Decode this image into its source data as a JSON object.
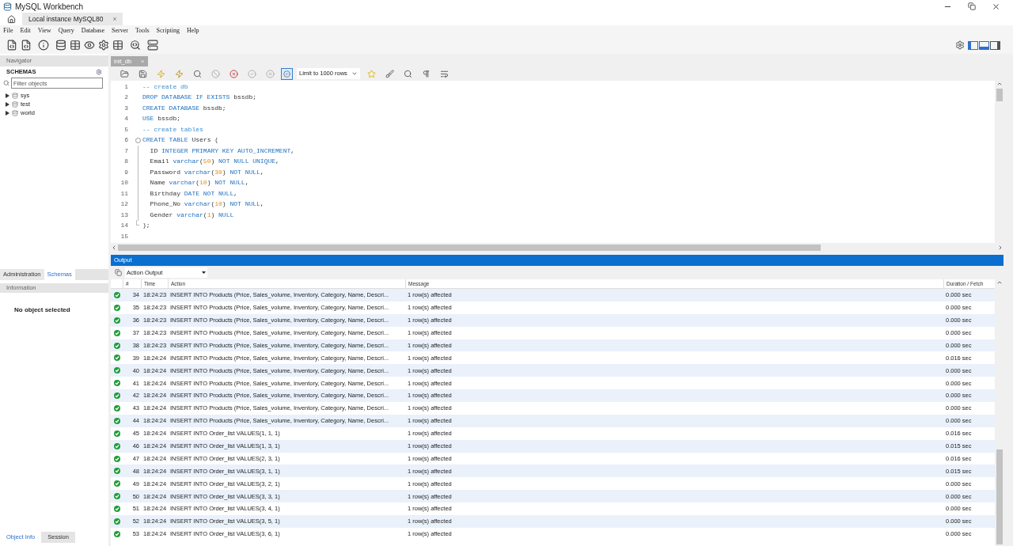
{
  "window": {
    "title": "MySQL Workbench"
  },
  "connection_tab": {
    "label": "Local instance MySQL80",
    "close": "×"
  },
  "menu": [
    "File",
    "Edit",
    "View",
    "Query",
    "Database",
    "Server",
    "Tools",
    "Scripting",
    "Help"
  ],
  "navigator": {
    "title": "Navigator",
    "section": "SCHEMAS",
    "filter_placeholder": "Filter objects",
    "schemas": [
      {
        "name": "sys",
        "expanded": false
      },
      {
        "name": "test",
        "expanded": false
      },
      {
        "name": "world",
        "expanded": false
      }
    ]
  },
  "side_tabs": [
    {
      "label": "Administration",
      "selected": false
    },
    {
      "label": "Schemas",
      "selected": true
    }
  ],
  "information": {
    "title": "Information",
    "message": "No object selected"
  },
  "info_tabs": [
    {
      "label": "Object Info",
      "selected": true
    },
    {
      "label": "Session",
      "selected": false
    }
  ],
  "editor": {
    "tab": "init_db",
    "tab_close": "×",
    "limit": "Limit to 1000 rows",
    "lines": [
      {
        "number": "1",
        "kind": "plain",
        "tokens": [
          {
            "kind": "comment",
            "text": "-- create db"
          }
        ]
      },
      {
        "number": "2",
        "kind": "plain",
        "tokens": [
          {
            "kind": "keyword",
            "text": "DROP DATABASE IF EXISTS "
          },
          {
            "kind": "ident",
            "text": "bssdb;"
          }
        ]
      },
      {
        "number": "3",
        "kind": "plain",
        "tokens": [
          {
            "kind": "keyword",
            "text": "CREATE DATABASE "
          },
          {
            "kind": "ident",
            "text": "bssdb;"
          }
        ]
      },
      {
        "number": "4",
        "kind": "plain",
        "tokens": [
          {
            "kind": "keyword",
            "text": "USE "
          },
          {
            "kind": "ident",
            "text": "bssdb;"
          }
        ]
      },
      {
        "number": "5",
        "kind": "plain",
        "tokens": [
          {
            "kind": "comment",
            "text": "-- create tables"
          }
        ]
      },
      {
        "number": "6",
        "kind": "fold_start",
        "tokens": [
          {
            "kind": "keyword",
            "text": "CREATE TABLE "
          },
          {
            "kind": "ident",
            "text": "Users ("
          }
        ]
      },
      {
        "number": "7",
        "kind": "fold_body",
        "tokens": [
          {
            "kind": "ident",
            "text": "  ID "
          },
          {
            "kind": "keyword",
            "text": "INTEGER PRIMARY KEY AUTO_INCREMENT"
          },
          {
            "kind": "ident",
            "text": ","
          }
        ]
      },
      {
        "number": "8",
        "kind": "fold_body",
        "tokens": [
          {
            "kind": "ident",
            "text": "  Email "
          },
          {
            "kind": "keyword",
            "text": "varchar"
          },
          {
            "kind": "ident",
            "text": "("
          },
          {
            "kind": "number",
            "text": "50"
          },
          {
            "kind": "ident",
            "text": ") "
          },
          {
            "kind": "keyword",
            "text": "NOT NULL UNIQUE"
          },
          {
            "kind": "ident",
            "text": ","
          }
        ]
      },
      {
        "number": "9",
        "kind": "fold_body",
        "tokens": [
          {
            "kind": "ident",
            "text": "  Password "
          },
          {
            "kind": "keyword",
            "text": "varchar"
          },
          {
            "kind": "ident",
            "text": "("
          },
          {
            "kind": "number",
            "text": "30"
          },
          {
            "kind": "ident",
            "text": ") "
          },
          {
            "kind": "keyword",
            "text": "NOT NULL"
          },
          {
            "kind": "ident",
            "text": ","
          }
        ]
      },
      {
        "number": "10",
        "kind": "fold_body",
        "tokens": [
          {
            "kind": "ident",
            "text": "  Name "
          },
          {
            "kind": "keyword",
            "text": "varchar"
          },
          {
            "kind": "ident",
            "text": "("
          },
          {
            "kind": "number",
            "text": "10"
          },
          {
            "kind": "ident",
            "text": ") "
          },
          {
            "kind": "keyword",
            "text": "NOT NULL"
          },
          {
            "kind": "ident",
            "text": ","
          }
        ]
      },
      {
        "number": "11",
        "kind": "fold_body",
        "tokens": [
          {
            "kind": "ident",
            "text": "  Birthday "
          },
          {
            "kind": "keyword",
            "text": "DATE NOT NULL"
          },
          {
            "kind": "ident",
            "text": ","
          }
        ]
      },
      {
        "number": "12",
        "kind": "fold_body",
        "tokens": [
          {
            "kind": "ident",
            "text": "  Phone_No "
          },
          {
            "kind": "keyword",
            "text": "varchar"
          },
          {
            "kind": "ident",
            "text": "("
          },
          {
            "kind": "number",
            "text": "10"
          },
          {
            "kind": "ident",
            "text": ") "
          },
          {
            "kind": "keyword",
            "text": "NOT NULL"
          },
          {
            "kind": "ident",
            "text": ","
          }
        ]
      },
      {
        "number": "13",
        "kind": "fold_body",
        "tokens": [
          {
            "kind": "ident",
            "text": "  Gender "
          },
          {
            "kind": "keyword",
            "text": "varchar"
          },
          {
            "kind": "ident",
            "text": "("
          },
          {
            "kind": "number",
            "text": "1"
          },
          {
            "kind": "ident",
            "text": ") "
          },
          {
            "kind": "keyword",
            "text": "NULL"
          }
        ]
      },
      {
        "number": "14",
        "kind": "fold_end",
        "tokens": [
          {
            "kind": "ident",
            "text": ");"
          }
        ]
      },
      {
        "number": "15",
        "kind": "plain"
      }
    ]
  },
  "output": {
    "title": "Output",
    "selector": "Action Output",
    "columns": [
      "#",
      "Time",
      "Action",
      "Message",
      "Duration / Fetch"
    ],
    "rows": [
      {
        "success": true,
        "number": "34",
        "time": "18:24:23",
        "action": "INSERT INTO Products (Price, Sales_volume, Inventory, Category, Name, Descri...",
        "message": "1 row(s) affected",
        "duration": "0.000 sec"
      },
      {
        "success": true,
        "number": "35",
        "time": "18:24:23",
        "action": "INSERT INTO Products (Price, Sales_volume, Inventory, Category, Name, Descri...",
        "message": "1 row(s) affected",
        "duration": "0.000 sec"
      },
      {
        "success": true,
        "number": "36",
        "time": "18:24:23",
        "action": "INSERT INTO Products (Price, Sales_volume, Inventory, Category, Name, Descri...",
        "message": "1 row(s) affected",
        "duration": "0.000 sec"
      },
      {
        "success": true,
        "number": "37",
        "time": "18:24:23",
        "action": "INSERT INTO Products (Price, Sales_volume, Inventory, Category, Name, Descri...",
        "message": "1 row(s) affected",
        "duration": "0.000 sec"
      },
      {
        "success": true,
        "number": "38",
        "time": "18:24:23",
        "action": "INSERT INTO Products (Price, Sales_volume, Inventory, Category, Name, Descri...",
        "message": "1 row(s) affected",
        "duration": "0.000 sec"
      },
      {
        "success": true,
        "number": "39",
        "time": "18:24:24",
        "action": "INSERT INTO Products (Price, Sales_volume, Inventory, Category, Name, Descri...",
        "message": "1 row(s) affected",
        "duration": "0.016 sec"
      },
      {
        "success": true,
        "number": "40",
        "time": "18:24:24",
        "action": "INSERT INTO Products (Price, Sales_volume, Inventory, Category, Name, Descri...",
        "message": "1 row(s) affected",
        "duration": "0.000 sec"
      },
      {
        "success": true,
        "number": "41",
        "time": "18:24:24",
        "action": "INSERT INTO Products (Price, Sales_volume, Inventory, Category, Name, Descri...",
        "message": "1 row(s) affected",
        "duration": "0.000 sec"
      },
      {
        "success": true,
        "number": "42",
        "time": "18:24:24",
        "action": "INSERT INTO Products (Price, Sales_volume, Inventory, Category, Name, Descri...",
        "message": "1 row(s) affected",
        "duration": "0.000 sec"
      },
      {
        "success": true,
        "number": "43",
        "time": "18:24:24",
        "action": "INSERT INTO Products (Price, Sales_volume, Inventory, Category, Name, Descri...",
        "message": "1 row(s) affected",
        "duration": "0.000 sec"
      },
      {
        "success": true,
        "number": "44",
        "time": "18:24:24",
        "action": "INSERT INTO Products (Price, Sales_volume, Inventory, Category, Name, Descri...",
        "message": "1 row(s) affected",
        "duration": "0.000 sec"
      },
      {
        "success": true,
        "number": "45",
        "time": "18:24:24",
        "action": "INSERT INTO Order_list VALUES(1, 1, 1)",
        "message": "1 row(s) affected",
        "duration": "0.016 sec"
      },
      {
        "success": true,
        "number": "46",
        "time": "18:24:24",
        "action": "INSERT INTO Order_list VALUES(1, 3, 1)",
        "message": "1 row(s) affected",
        "duration": "0.015 sec"
      },
      {
        "success": true,
        "number": "47",
        "time": "18:24:24",
        "action": "INSERT INTO Order_list VALUES(2, 3, 1)",
        "message": "1 row(s) affected",
        "duration": "0.016 sec"
      },
      {
        "success": true,
        "number": "48",
        "time": "18:24:24",
        "action": "INSERT INTO Order_list VALUES(3, 1, 1)",
        "message": "1 row(s) affected",
        "duration": "0.015 sec"
      },
      {
        "success": true,
        "number": "49",
        "time": "18:24:24",
        "action": "INSERT INTO Order_list VALUES(3, 2, 1)",
        "message": "1 row(s) affected",
        "duration": "0.000 sec"
      },
      {
        "success": true,
        "number": "50",
        "time": "18:24:24",
        "action": "INSERT INTO Order_list VALUES(3, 3, 1)",
        "message": "1 row(s) affected",
        "duration": "0.000 sec"
      },
      {
        "success": true,
        "number": "51",
        "time": "18:24:24",
        "action": "INSERT INTO Order_list VALUES(3, 4, 1)",
        "message": "1 row(s) affected",
        "duration": "0.000 sec"
      },
      {
        "success": true,
        "number": "52",
        "time": "18:24:24",
        "action": "INSERT INTO Order_list VALUES(3, 5, 1)",
        "message": "1 row(s) affected",
        "duration": "0.000 sec"
      },
      {
        "success": true,
        "number": "53",
        "time": "18:24:24",
        "action": "INSERT INTO Order_list VALUES(3, 6, 1)",
        "message": "1 row(s) affected",
        "duration": "0.000 sec"
      }
    ]
  }
}
